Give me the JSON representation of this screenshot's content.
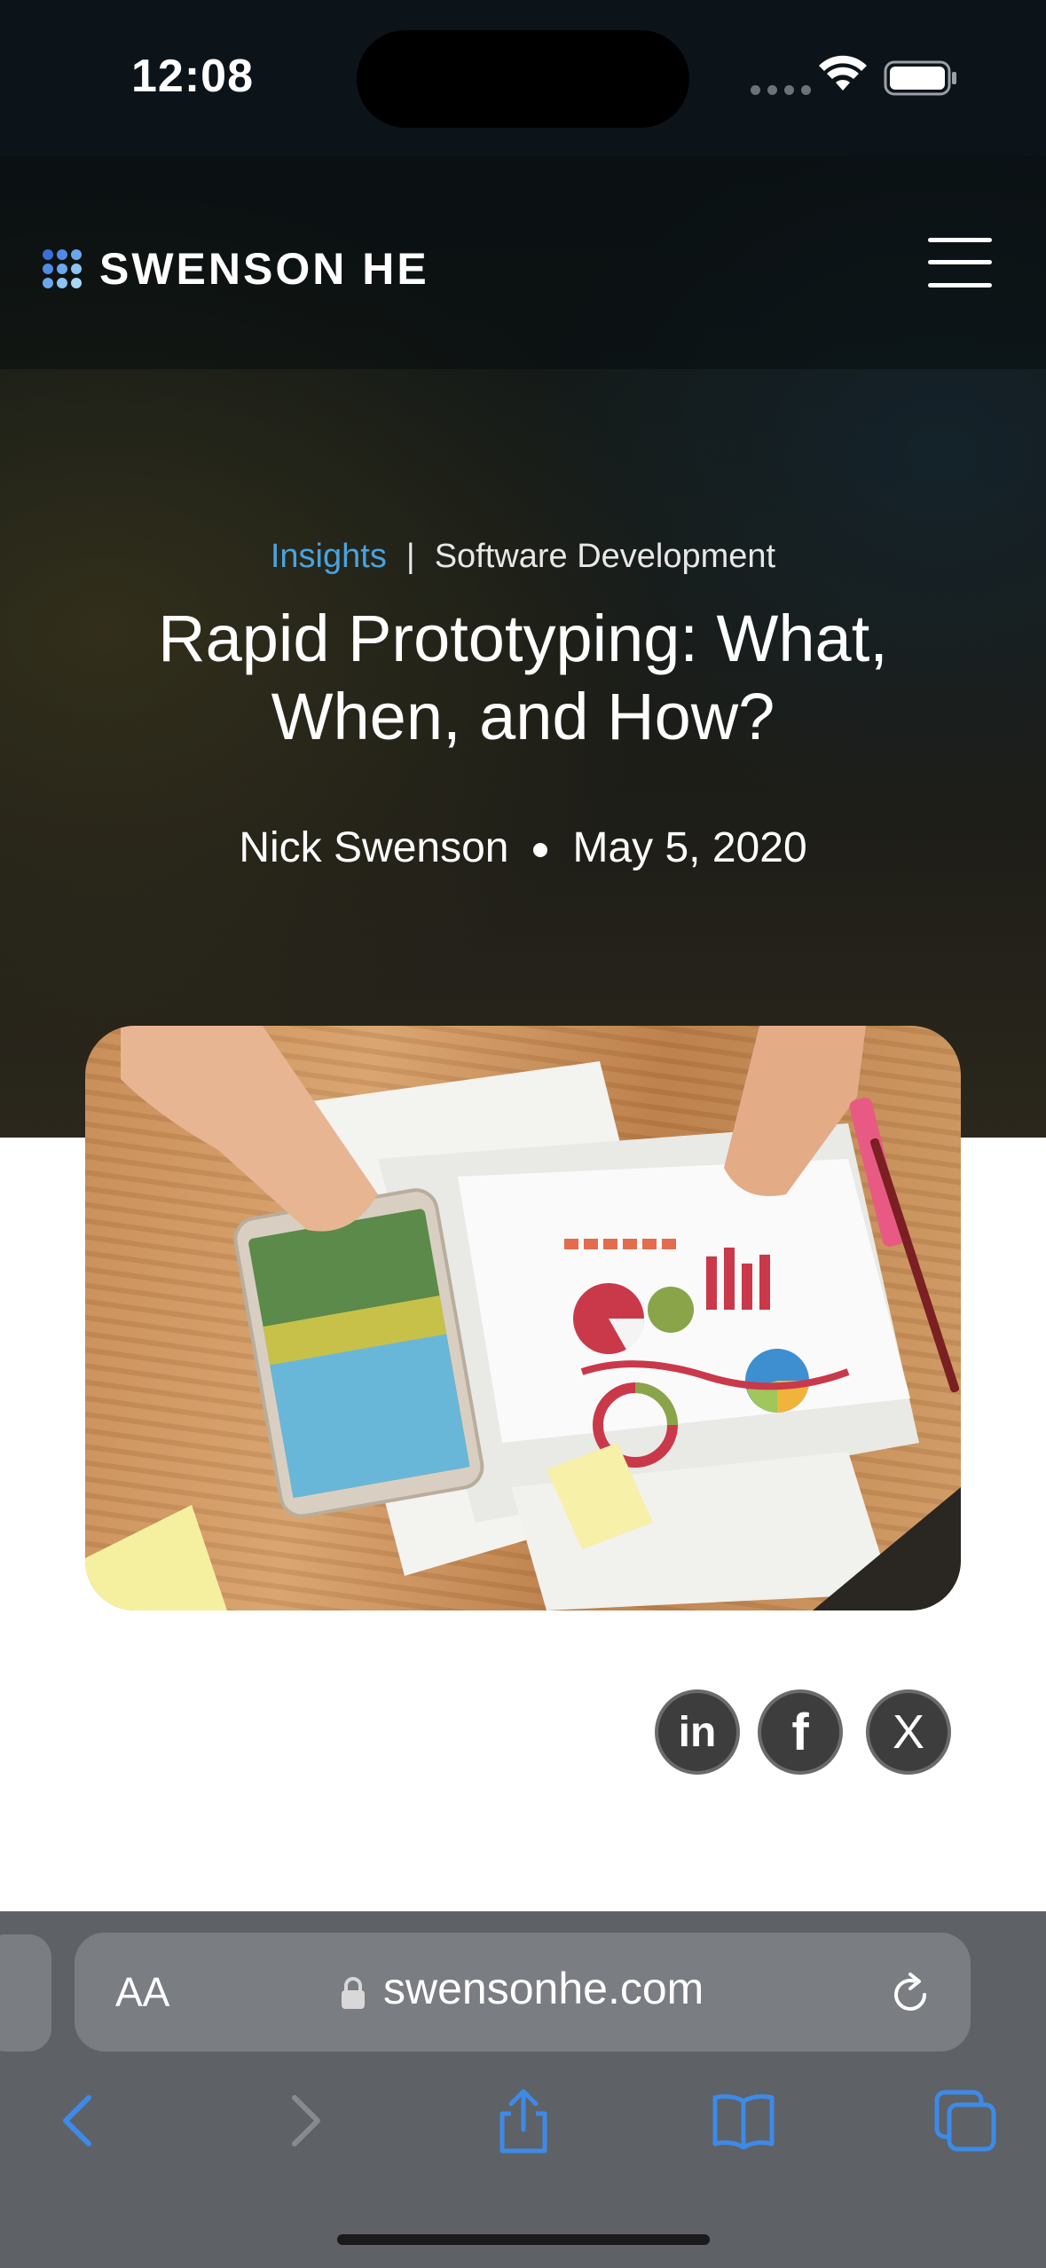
{
  "status_bar": {
    "time": "12:08"
  },
  "header": {
    "logo_text": "SWENSON HE",
    "menu_icon": "hamburger-menu-icon"
  },
  "article": {
    "category": "Insights",
    "separator": "|",
    "subcategory": "Software Development",
    "title": "Rapid Prototyping: What, When, and How?",
    "author": "Nick Swenson",
    "date": "May 5, 2020",
    "image_description": "tablet-and-charts-on-desk-photo"
  },
  "share": {
    "linkedin_label": "in",
    "facebook_label": "f",
    "x_label": "X"
  },
  "browser": {
    "text_size_label": "AA",
    "url": "swensonhe.com"
  },
  "colors": {
    "accent_link": "#4aa3e0",
    "browser_toolbar": "#5e6166",
    "toolbar_icon": "#3d8ae8"
  }
}
